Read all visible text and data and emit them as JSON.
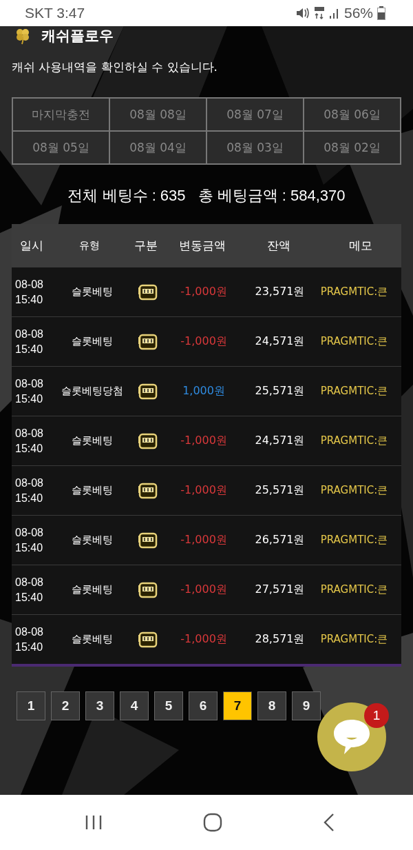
{
  "status_bar": {
    "carrier_time": "SKT 3:47",
    "battery": "56%"
  },
  "header": {
    "title": "캐쉬플로우",
    "subtitle": "캐쉬 사용내역을 확인하실 수 있습니다."
  },
  "date_tabs": [
    {
      "label": "마지막충전",
      "selected": false
    },
    {
      "label": "08월 08일",
      "selected": false
    },
    {
      "label": "08월 07일",
      "selected": false
    },
    {
      "label": "08월 06일",
      "selected": false
    },
    {
      "label": "08월 05일",
      "selected": false
    },
    {
      "label": "08월 04일",
      "selected": false
    },
    {
      "label": "08월 03일",
      "selected": false
    },
    {
      "label": "08월 02일",
      "selected": false
    }
  ],
  "summary": {
    "count_label": "전체 베팅수 : 635",
    "amount_label": "총 베팅금액 : 584,370"
  },
  "table": {
    "columns": [
      "일시",
      "유형",
      "구분",
      "변동금액",
      "잔액",
      "메모"
    ],
    "rows": [
      {
        "date": "08-08",
        "time": "15:40",
        "type": "슬롯베팅",
        "kind": "debit",
        "amount": "-1,000원",
        "balance": "23,571원",
        "memo": "PRAGMTIC:큰"
      },
      {
        "date": "08-08",
        "time": "15:40",
        "type": "슬롯베팅",
        "kind": "debit",
        "amount": "-1,000원",
        "balance": "24,571원",
        "memo": "PRAGMTIC:큰"
      },
      {
        "date": "08-08",
        "time": "15:40",
        "type": "슬롯베팅당첨",
        "kind": "credit",
        "amount": "1,000원",
        "balance": "25,571원",
        "memo": "PRAGMTIC:큰"
      },
      {
        "date": "08-08",
        "time": "15:40",
        "type": "슬롯베팅",
        "kind": "debit",
        "amount": "-1,000원",
        "balance": "24,571원",
        "memo": "PRAGMTIC:큰"
      },
      {
        "date": "08-08",
        "time": "15:40",
        "type": "슬롯베팅",
        "kind": "debit",
        "amount": "-1,000원",
        "balance": "25,571원",
        "memo": "PRAGMTIC:큰"
      },
      {
        "date": "08-08",
        "time": "15:40",
        "type": "슬롯베팅",
        "kind": "debit",
        "amount": "-1,000원",
        "balance": "26,571원",
        "memo": "PRAGMTIC:큰"
      },
      {
        "date": "08-08",
        "time": "15:40",
        "type": "슬롯베팅",
        "kind": "debit",
        "amount": "-1,000원",
        "balance": "27,571원",
        "memo": "PRAGMTIC:큰"
      },
      {
        "date": "08-08",
        "time": "15:40",
        "type": "슬롯베팅",
        "kind": "debit",
        "amount": "-1,000원",
        "balance": "28,571원",
        "memo": "PRAGMTIC:큰"
      }
    ]
  },
  "pagination": [
    {
      "label": "1",
      "selected": false
    },
    {
      "label": "2",
      "selected": false
    },
    {
      "label": "3",
      "selected": false
    },
    {
      "label": "4",
      "selected": false
    },
    {
      "label": "5",
      "selected": false
    },
    {
      "label": "6",
      "selected": false
    },
    {
      "label": "7",
      "selected": true
    },
    {
      "label": "8",
      "selected": false
    },
    {
      "label": "9",
      "selected": false
    }
  ],
  "chat": {
    "badge": "1"
  }
}
